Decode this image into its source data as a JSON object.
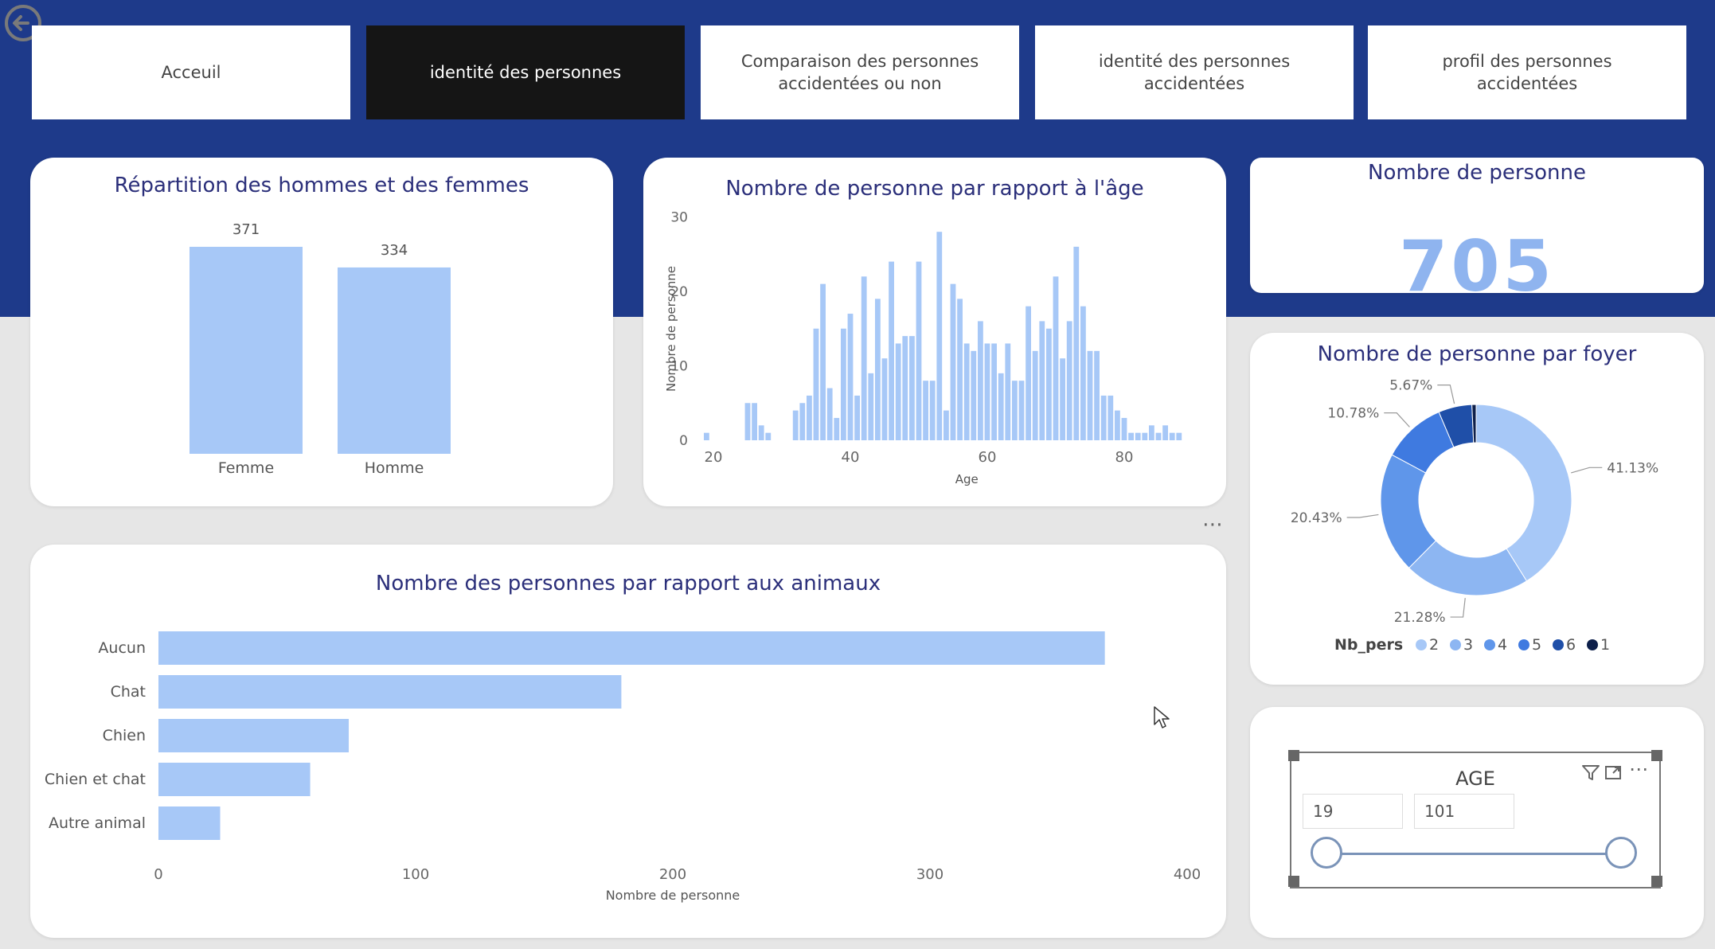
{
  "nav": {
    "tabs": [
      {
        "label": "Acceuil"
      },
      {
        "label": "identité des personnes"
      },
      {
        "label": "Comparaison des personnes accidentées ou non"
      },
      {
        "label": "identité des personnes accidentées"
      },
      {
        "label": "profil des personnes accidentées"
      }
    ],
    "active_index": 1
  },
  "colors": {
    "band": "#1e3a8a",
    "bar": "#a7c8f7",
    "title": "#2b2f7a",
    "kpi": "#8fb4ef"
  },
  "kpi": {
    "title": "Nombre de personne",
    "value": "705"
  },
  "slicer": {
    "title": "AGE",
    "min_value": "19",
    "max_value": "101",
    "icons": [
      "filter-icon",
      "focus-mode-icon",
      "more-options-icon"
    ]
  },
  "chart_data": [
    {
      "type": "bar",
      "title": "Répartition des hommes et des femmes",
      "categories": [
        "Femme",
        "Homme"
      ],
      "values": [
        371,
        334
      ],
      "data_labels": [
        "371",
        "334"
      ]
    },
    {
      "type": "bar",
      "title": "Nombre de personne par rapport à l'âge",
      "xlabel": "Age",
      "ylabel": "Nombre de personne",
      "xlim": [
        19,
        89
      ],
      "ylim": [
        0,
        30
      ],
      "x_ticks": [
        "20",
        "40",
        "60",
        "80"
      ],
      "y_ticks": [
        "0",
        "10",
        "20",
        "30"
      ],
      "x": [
        19,
        25,
        26,
        27,
        28,
        32,
        33,
        34,
        35,
        36,
        37,
        38,
        39,
        40,
        41,
        42,
        43,
        44,
        45,
        46,
        47,
        48,
        49,
        50,
        51,
        52,
        53,
        54,
        55,
        56,
        57,
        58,
        59,
        60,
        61,
        62,
        63,
        64,
        65,
        66,
        67,
        68,
        69,
        70,
        71,
        72,
        73,
        74,
        75,
        76,
        77,
        78,
        79,
        80,
        81,
        82,
        83,
        84,
        85,
        86,
        87,
        88
      ],
      "values": [
        1,
        5,
        5,
        2,
        1,
        4,
        5,
        6,
        15,
        21,
        7,
        3,
        15,
        17,
        6,
        22,
        9,
        19,
        11,
        24,
        13,
        14,
        14,
        24,
        8,
        8,
        28,
        4,
        21,
        19,
        13,
        12,
        16,
        13,
        13,
        9,
        13,
        8,
        8,
        18,
        12,
        16,
        15,
        22,
        11,
        16,
        26,
        18,
        12,
        12,
        6,
        6,
        4,
        3,
        1,
        1,
        1,
        2,
        1,
        2,
        1,
        1
      ]
    },
    {
      "type": "pie",
      "title": "Nombre de personne par foyer",
      "legend_title": "Nb_pers",
      "legend_position": "bottom",
      "categories": [
        "2",
        "3",
        "4",
        "5",
        "6",
        "1"
      ],
      "values": [
        41.13,
        21.28,
        20.43,
        10.78,
        5.67,
        0.71
      ],
      "labels": [
        "41.13%",
        "21.28%",
        "20.43%",
        "10.78%",
        "5.67%",
        ""
      ],
      "colors": [
        "#a7c8f7",
        "#8db6f2",
        "#5f96ea",
        "#3f7ae0",
        "#1f4fa8",
        "#0d1f4a"
      ]
    },
    {
      "type": "bar",
      "orientation": "horizontal",
      "title": "Nombre des personnes par rapport aux animaux",
      "xlabel": "Nombre de personne",
      "categories": [
        "Aucun",
        "Chat",
        "Chien",
        "Chien et chat",
        "Autre animal"
      ],
      "values": [
        368,
        180,
        74,
        59,
        24
      ],
      "xlim": [
        0,
        400
      ],
      "x_ticks": [
        "0",
        "100",
        "200",
        "300",
        "400"
      ]
    }
  ]
}
